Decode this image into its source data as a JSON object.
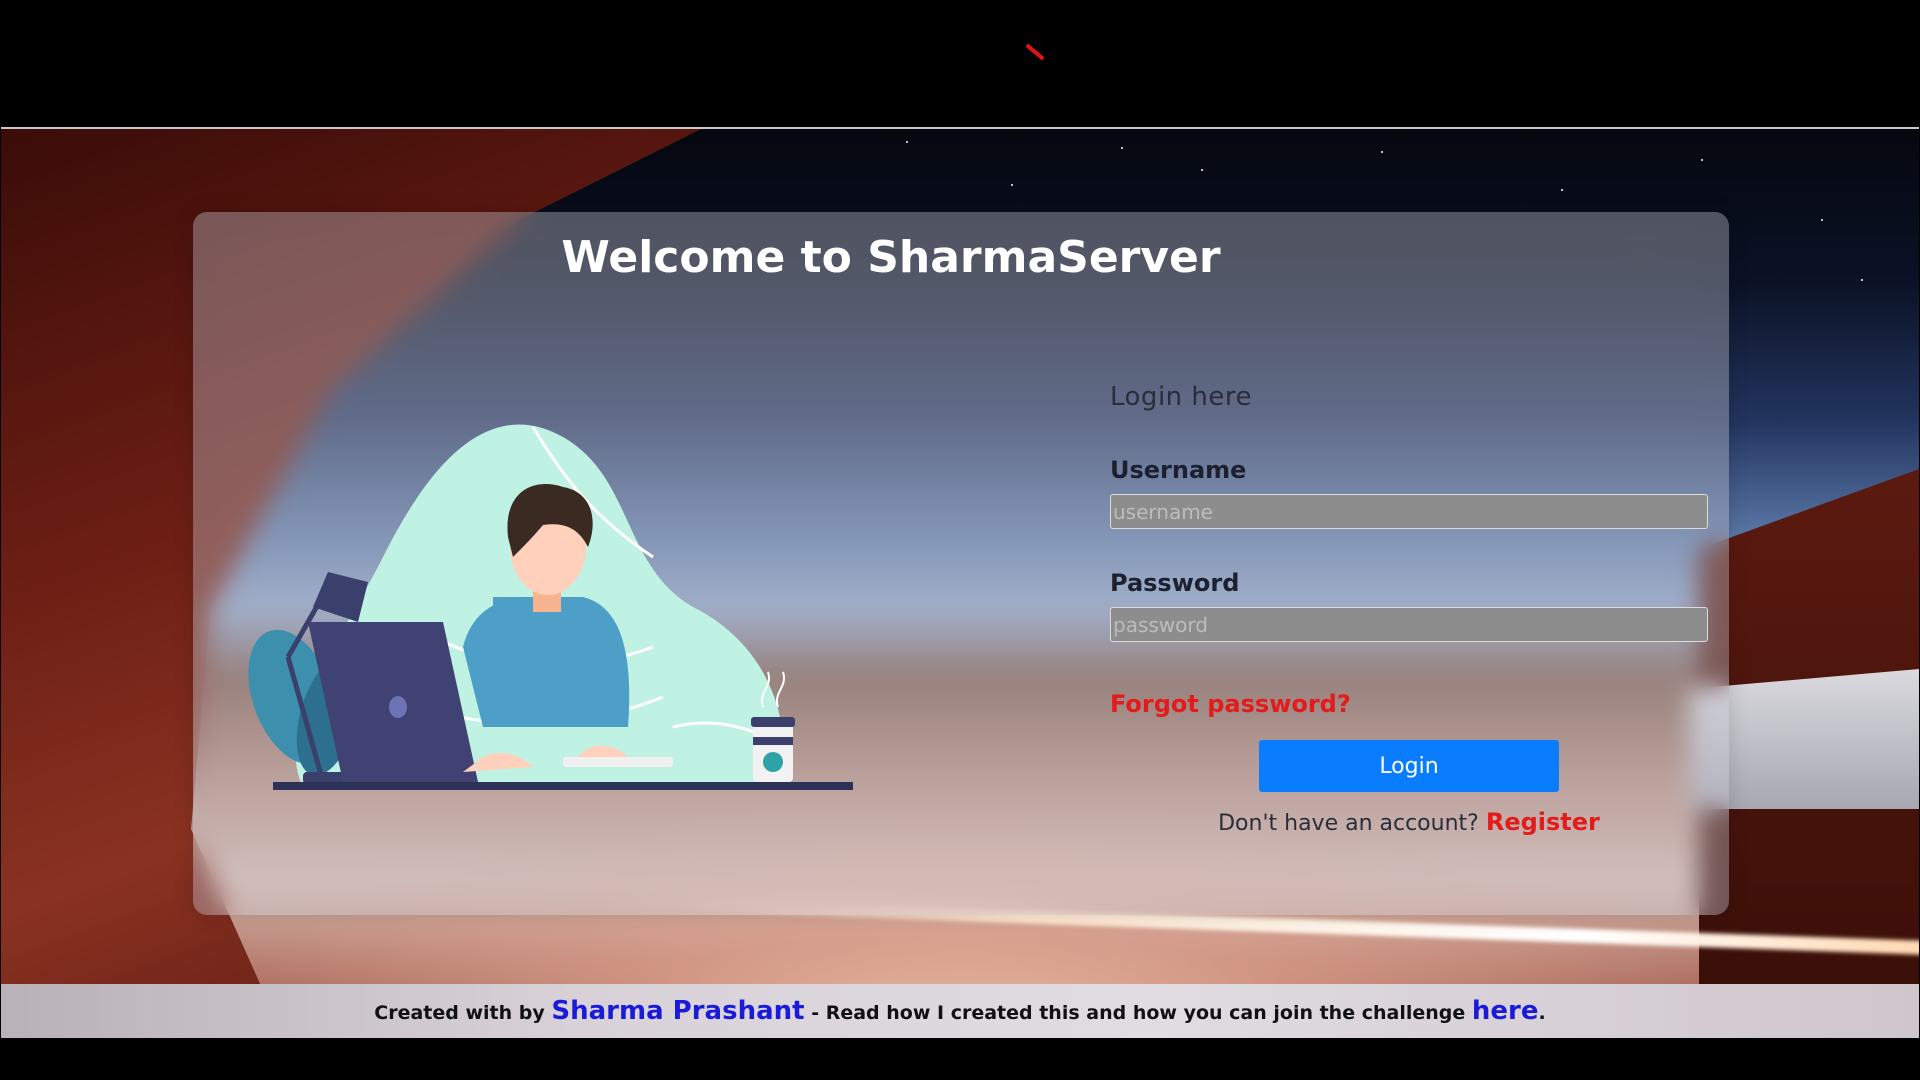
{
  "card": {
    "title": "Welcome to SharmaServer"
  },
  "login": {
    "heading": "Login here",
    "username_label": "Username",
    "username_placeholder": "username",
    "password_label": "Password",
    "password_placeholder": "password",
    "forgot_label": "Forgot password?",
    "submit_label": "Login",
    "register_prompt": "Don't have an account?",
    "register_label": "Register"
  },
  "footer": {
    "prefix": "Created with by",
    "author": "Sharma Prashant",
    "middle": "- Read how I created this and how you can join the challenge",
    "link": "here",
    "suffix": "."
  },
  "colors": {
    "accent_blue": "#0a7dff",
    "link_red": "#e31b1b",
    "footer_link": "#1a1adb"
  },
  "icons": [
    "loading-icon",
    "person-at-laptop-illustration"
  ]
}
